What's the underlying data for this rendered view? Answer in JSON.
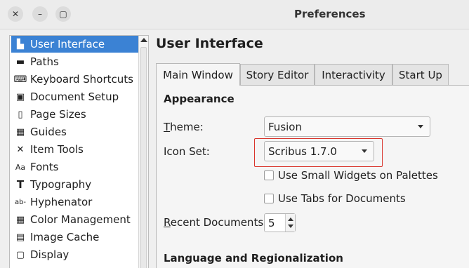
{
  "window": {
    "title": "Preferences",
    "close_glyph": "✕",
    "minimize_glyph": "–",
    "maximize_glyph": "▢"
  },
  "sidebar": {
    "items": [
      {
        "label": "User Interface",
        "icon": "ui-icon",
        "glyph": "▙",
        "selected": true
      },
      {
        "label": "Paths",
        "icon": "folder-icon",
        "glyph": "▬"
      },
      {
        "label": "Keyboard Shortcuts",
        "icon": "keyboard-icon",
        "glyph": "⌨"
      },
      {
        "label": "Document Setup",
        "icon": "document-setup-icon",
        "glyph": "▣"
      },
      {
        "label": "Page Sizes",
        "icon": "page-icon",
        "glyph": "▯"
      },
      {
        "label": "Guides",
        "icon": "guides-icon",
        "glyph": "▦"
      },
      {
        "label": "Item Tools",
        "icon": "tools-icon",
        "glyph": "✕"
      },
      {
        "label": "Fonts",
        "icon": "fonts-icon",
        "glyph": "Aa"
      },
      {
        "label": "Typography",
        "icon": "typography-icon",
        "glyph": "T"
      },
      {
        "label": "Hyphenator",
        "icon": "hyphenator-icon",
        "glyph": "ab-"
      },
      {
        "label": "Color Management",
        "icon": "color-management-icon",
        "glyph": "▦"
      },
      {
        "label": "Image Cache",
        "icon": "image-cache-icon",
        "glyph": "▤"
      },
      {
        "label": "Display",
        "icon": "display-icon",
        "glyph": "▢"
      }
    ]
  },
  "main": {
    "title": "User Interface",
    "tabs": [
      {
        "label": "Main Window",
        "active": true
      },
      {
        "label": "Story Editor"
      },
      {
        "label": "Interactivity"
      },
      {
        "label": "Start Up"
      }
    ],
    "appearance": {
      "heading": "Appearance",
      "theme_label_accel": "T",
      "theme_label_rest": "heme:",
      "theme_value": "Fusion",
      "icon_set_label": "Icon Set:",
      "icon_set_value": "Scribus 1.7.0",
      "small_widgets_label": "Use Small Widgets on Palettes",
      "small_widgets_checked": false,
      "tabs_docs_label": "Use Tabs for Documents",
      "tabs_docs_checked": false,
      "recent_docs_label_accel": "R",
      "recent_docs_label_rest": "ecent Documents:",
      "recent_docs_value": "5"
    },
    "language_heading": "Language and Regionalization"
  },
  "colors": {
    "selection": "#3b82d4",
    "highlight_box": "#d9342b"
  }
}
